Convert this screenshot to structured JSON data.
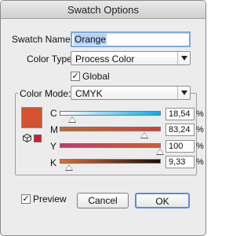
{
  "window": {
    "title": "Swatch Options"
  },
  "swatch_name": {
    "label": "Swatch Name:",
    "value": "Orange"
  },
  "color_type": {
    "label": "Color Type:",
    "value": "Process Color"
  },
  "global": {
    "label": "Global",
    "checked": true,
    "check_glyph": "✓"
  },
  "color_mode": {
    "label": "Color Mode:",
    "value": "CMYK"
  },
  "channels": [
    {
      "label": "C",
      "value": "18,54",
      "unit": "%"
    },
    {
      "label": "M",
      "value": "83,24",
      "unit": "%"
    },
    {
      "label": "Y",
      "value": "100",
      "unit": "%"
    },
    {
      "label": "K",
      "value": "9,33",
      "unit": "%"
    }
  ],
  "preview": {
    "label": "Preview",
    "checked": true,
    "check_glyph": "✓"
  },
  "buttons": {
    "cancel": "Cancel",
    "ok": "OK"
  },
  "colors": {
    "swatch": "#d35230",
    "out_of_gamut": "#d51d2c",
    "focus": "#7ea9dd"
  },
  "icons": {
    "out_of_gamut": "cube-warning-icon",
    "dropdown": "chevron-down-icon"
  }
}
